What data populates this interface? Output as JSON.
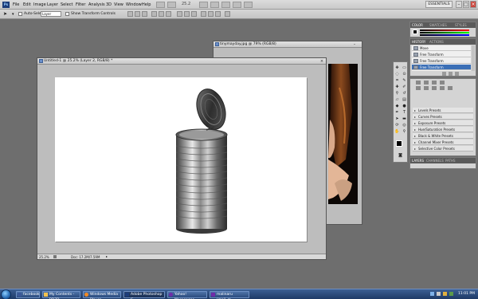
{
  "menubar": {
    "items": [
      "File",
      "Edit",
      "Image",
      "Layer",
      "Select",
      "Filter",
      "Analysis",
      "3D",
      "View",
      "Window",
      "Help"
    ],
    "zoom": "25.2",
    "workspace": "ESSENTIALS"
  },
  "options": {
    "auto_select_label": "Auto-Select:",
    "auto_select_value": "Layer",
    "show_transform_label": "Show Transform Controls"
  },
  "doc_front": {
    "title": "Untitled-1 @ 25.2% (Layer 2, RGB/8) *",
    "zoom": "25.2%",
    "doc_info": "Doc: 17.2M/7.59M"
  },
  "doc_back": {
    "title": "tinymayday.jpg @ 79% (RGB/8)"
  },
  "panels": {
    "color_tabs": [
      "COLOR",
      "SWATCHES",
      "STYLES"
    ],
    "history_tabs": [
      "HISTORY",
      "ACTIONS"
    ],
    "history_items": [
      "Move",
      "Free Transform",
      "Free Transform",
      "Free Transform"
    ],
    "adjust_presets": [
      "Levels Presets",
      "Curves Presets",
      "Exposure Presets",
      "Hue/Saturation Presets",
      "Black & White Presets",
      "Channel Mixer Presets",
      "Selective Color Presets"
    ],
    "layers_tabs": [
      "LAYERS",
      "CHANNELS",
      "PATHS"
    ]
  },
  "taskbar": {
    "items": [
      "facebook - ...",
      "My Contents - PD7D...",
      "Windows Media Player",
      "Adobe Photoshop C...",
      "Yahoo! Messenger",
      "malinaru (mail_m..."
    ],
    "clock": "11:01 PM"
  },
  "colors": {
    "accent": "#3b6fb6",
    "taskbar": "#1e3a66",
    "canvas": "#ffffff",
    "workspace_bg": "#6e6e6e"
  }
}
